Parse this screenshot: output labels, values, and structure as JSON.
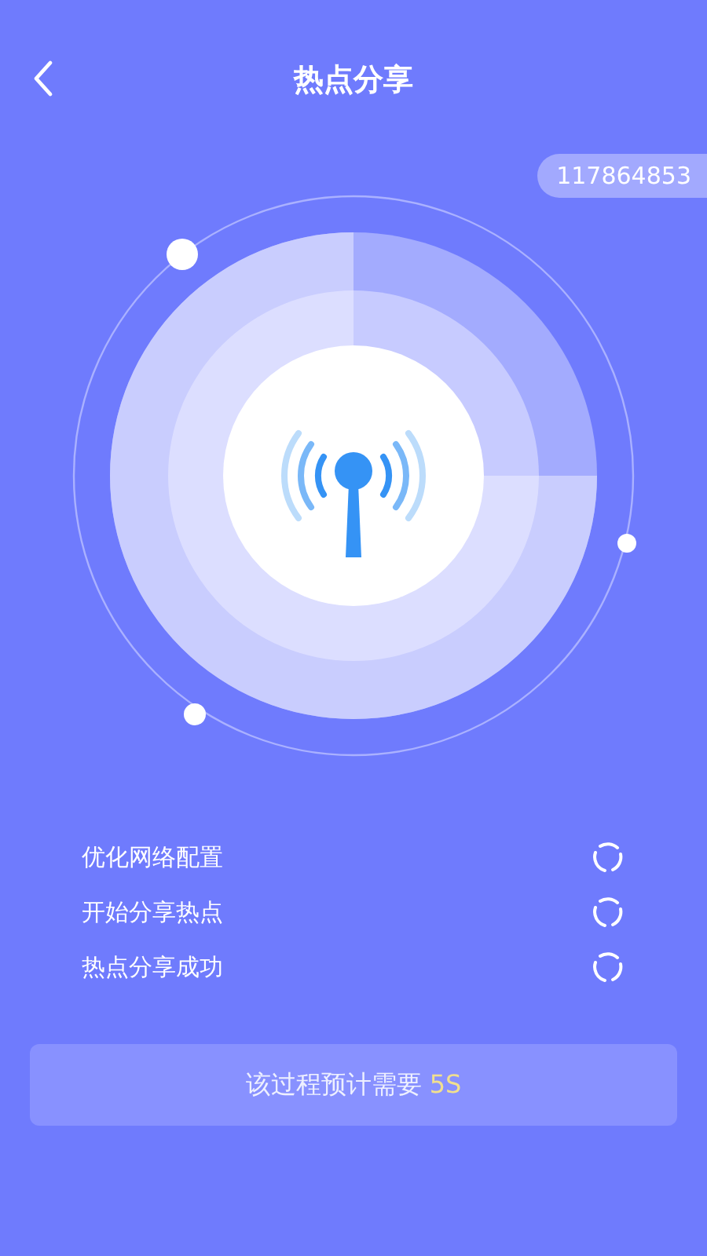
{
  "header": {
    "title": "热点分享"
  },
  "badge": "117864853",
  "steps": [
    {
      "label": "优化网络配置"
    },
    {
      "label": "开始分享热点"
    },
    {
      "label": "热点分享成功"
    }
  ],
  "status_button": {
    "text": "该过程预计需要",
    "duration": "5S"
  }
}
